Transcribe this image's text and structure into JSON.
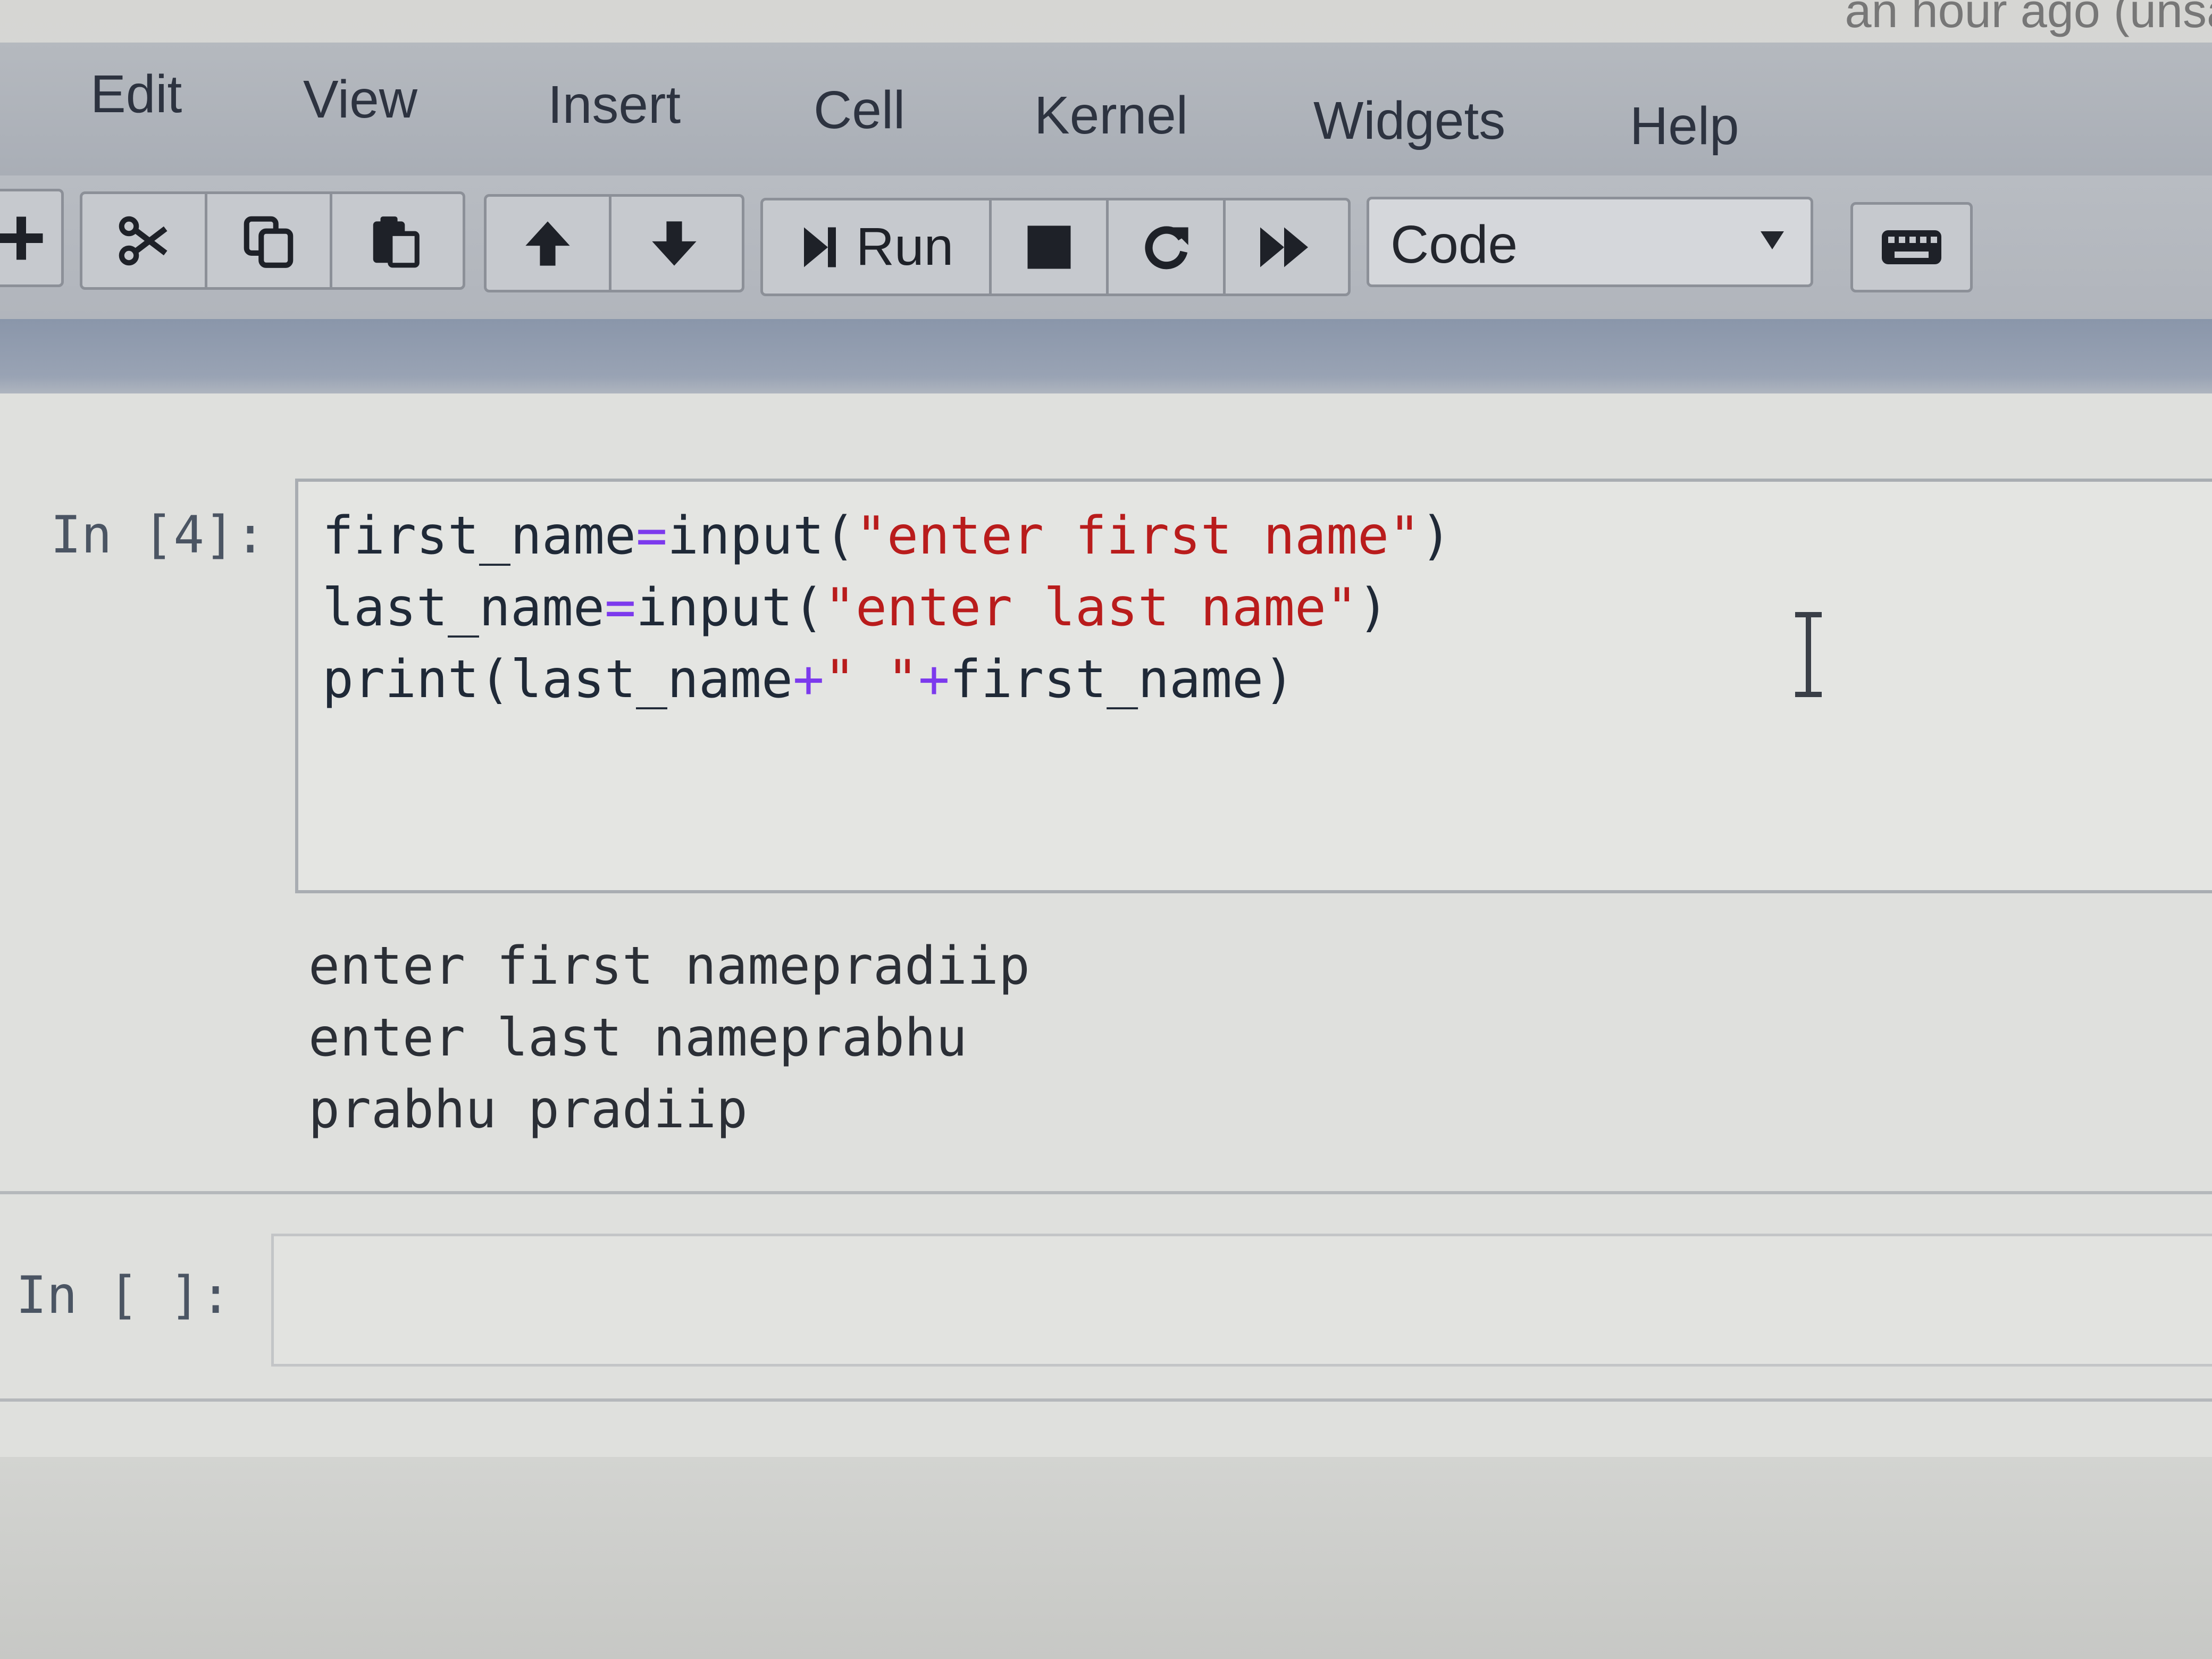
{
  "header": {
    "save_status": "an hour ago  (unsa"
  },
  "menubar": {
    "items": [
      {
        "label": "Edit"
      },
      {
        "label": "View"
      },
      {
        "label": "Insert"
      },
      {
        "label": "Cell"
      },
      {
        "label": "Kernel"
      },
      {
        "label": "Widgets"
      },
      {
        "label": "Help"
      }
    ]
  },
  "toolbar": {
    "buttons": [
      {
        "icon": "plus-icon"
      },
      {
        "icon": "cut-icon"
      },
      {
        "icon": "copy-icon"
      },
      {
        "icon": "paste-icon"
      },
      {
        "icon": "arrow-up-icon"
      },
      {
        "icon": "arrow-down-icon"
      },
      {
        "icon": "step-forward-icon",
        "label": "Run"
      },
      {
        "icon": "stop-icon"
      },
      {
        "icon": "restart-icon"
      },
      {
        "icon": "fast-forward-icon"
      },
      {
        "icon": "keyboard-icon"
      }
    ],
    "run_label": "Run",
    "cell_type": {
      "selected": "Code"
    }
  },
  "cells": [
    {
      "prompt": "In [4]:",
      "source": [
        {
          "parts": [
            "first_name",
            "=",
            "input(",
            "\"enter first name\"",
            ")"
          ]
        },
        {
          "parts": [
            "last_name",
            "=",
            "input(",
            "\"enter last name\"",
            ")"
          ]
        },
        {
          "parts": [
            "print(last_name",
            "+",
            "\" \"",
            "+",
            "first_name)"
          ]
        }
      ],
      "output": [
        "enter first namepradiip",
        "enter last nameprabhu",
        "prabhu pradiip"
      ]
    },
    {
      "prompt": "In [ ]:",
      "source": []
    }
  ],
  "colors": {
    "operator": "#7c3aed",
    "string": "#b91c1c",
    "menubar": "#a9aeb6",
    "toolbar": "#b1b5bc"
  }
}
